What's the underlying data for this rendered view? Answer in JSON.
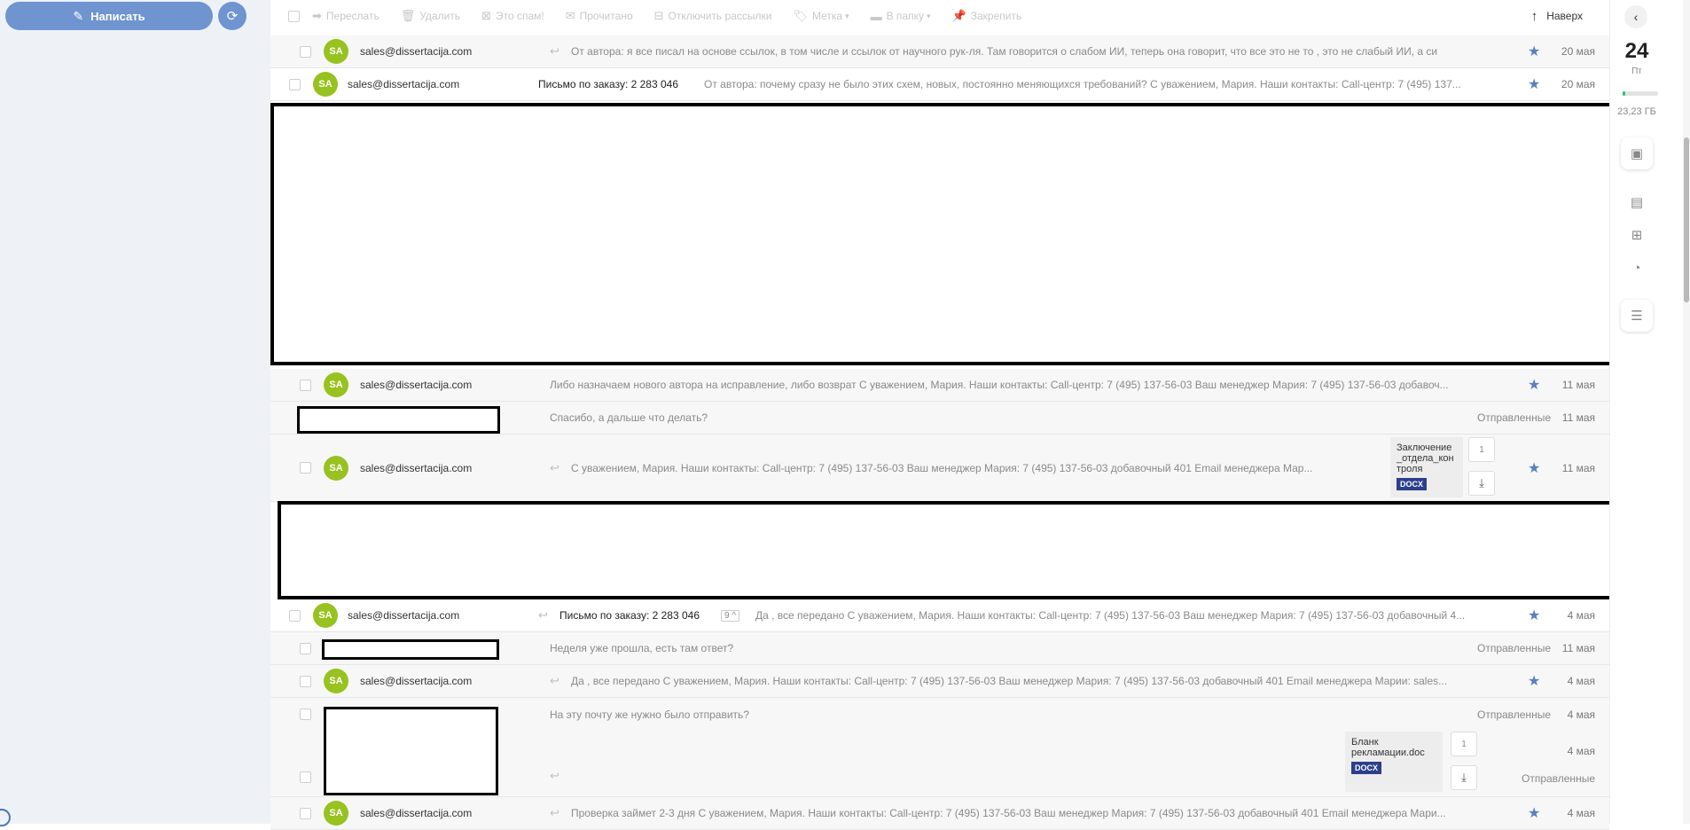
{
  "left": {
    "compose_label": "Написать",
    "compose_icon": "pencil-square-icon",
    "refresh_icon": "refresh-icon"
  },
  "toolbar": {
    "forward": "Переслать",
    "delete": "Удалить",
    "spam": "Это спам!",
    "read": "Прочитано",
    "unsubscribe": "Отключить рассылки",
    "label": "Метка",
    "to_folder": "В папку",
    "pin": "Закрепить",
    "top": "Наверх"
  },
  "emails": [
    {
      "sender": "sales@dissertacija.com",
      "avatar": "SA",
      "subject": "",
      "snippet": "От автора: я все писал на основе ссылок, в том числе и ссылок от научного рук-ля. Там говорится о слабом ИИ, теперь она говорит, что все это не то , это не слабый ИИ, а си",
      "date": "20 мая"
    },
    {
      "sender": "sales@dissertacija.com",
      "avatar": "SA",
      "subject": "Письмо по заказу: 2 283 046",
      "snippet": "От автора: почему сразу не было этих схем, новых, постоянно меняющихся требований? С уважением, Мария. Наши контакты: Call-центр: 7 (495) 137...",
      "date": "20 мая"
    },
    {
      "sender": "sales@dissertacija.com",
      "avatar": "SA",
      "snippet": "Либо назначаем нового автора на исправление, либо возврат С уважением, Мария. Наши контакты: Call-центр: 7 (495) 137-56-03 Ваш менеджер Мария: 7 (495) 137-56-03 добавоч...",
      "date": "11 мая"
    },
    {
      "snippet": "Спасибо, а дальше что делать?",
      "folder": "Отправленные",
      "date": "11 мая"
    },
    {
      "sender": "sales@dissertacija.com",
      "avatar": "SA",
      "snippet": "С уважением, Мария. Наши контакты: Call-центр: 7 (495) 137-56-03 Ваш менеджер Мария: 7 (495) 137-56-03 добавочный 401 Email менеджера Мар...",
      "attachment": "Заключение_отдела_контроля",
      "att_type": "DOCX",
      "att_count": "1",
      "date": "11 мая"
    },
    {
      "sender": "sales@dissertacija.com",
      "avatar": "SA",
      "subject": "Письмо по заказу: 2 283 046",
      "count": "9",
      "snippet": "Да , все передано С уважением, Мария. Наши контакты: Call-центр: 7 (495) 137-56-03 Ваш менеджер Мария: 7 (495) 137-56-03 добавочный 4...",
      "date": "4 мая"
    },
    {
      "snippet": "Неделя уже прошла, есть там ответ?",
      "folder": "Отправленные",
      "date": "11 мая"
    },
    {
      "sender": "sales@dissertacija.com",
      "avatar": "SA",
      "snippet": "Да , все передано С уважением, Мария. Наши контакты: Call-центр: 7 (495) 137-56-03 Ваш менеджер Мария: 7 (495) 137-56-03 добавочный 401 Email менеджера Марии: sales...",
      "date": "4 мая"
    },
    {
      "snippet": "На эту почту же нужно было отправить?",
      "folder": "Отправленные",
      "date": "4 мая"
    },
    {
      "attachment": "Бланк рекламации.doc",
      "att_type": "DOCX",
      "att_count": "1",
      "folder": "Отправленные",
      "date": "4 мая"
    },
    {
      "sender": "sales@dissertacija.com",
      "avatar": "SA",
      "snippet": "Проверка займет 2-3 дня С уважением, Мария. Наши контакты: Call-центр: 7 (495) 137-56-03 Ваш менеджер Мария: 7 (495) 137-56-03 добавочный 401 Email менеджера Мари...",
      "date": "4 мая"
    }
  ],
  "rail": {
    "day": "24",
    "dow": "Пт",
    "storage": "23,23 ГБ",
    "storage_used_fraction": 0.08
  }
}
